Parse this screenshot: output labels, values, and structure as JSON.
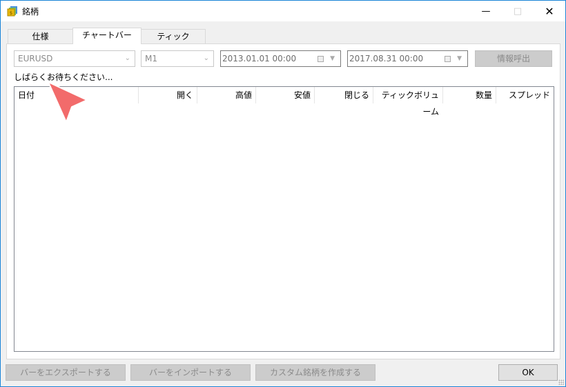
{
  "window": {
    "title": "銘柄",
    "minimize_icon": "minimize-icon",
    "maximize_icon": "maximize-icon",
    "close_icon": "close-icon"
  },
  "tabs": [
    {
      "label": "仕様",
      "selected": false
    },
    {
      "label": "チャートバー",
      "selected": true
    },
    {
      "label": "ティック",
      "selected": false
    }
  ],
  "toolbar": {
    "symbol": "EURUSD",
    "timeframe": "M1",
    "date_from": "2013.01.01 00:00",
    "date_to": "2017.08.31 00:00",
    "request_label": "情報呼出"
  },
  "status": "しばらくお待ちください...",
  "table": {
    "columns": [
      "日付",
      "開く",
      "高値",
      "安値",
      "閉じる",
      "ティックボリューム",
      "数量",
      "スプレッド"
    ],
    "rows": []
  },
  "footer": {
    "export_label": "バーをエクスポートする",
    "import_label": "バーをインポートする",
    "custom_label": "カスタム銘柄を作成する",
    "ok_label": "OK"
  },
  "colors": {
    "accent_border": "#1883d7",
    "cursor_annotation": "#f26b6b"
  }
}
